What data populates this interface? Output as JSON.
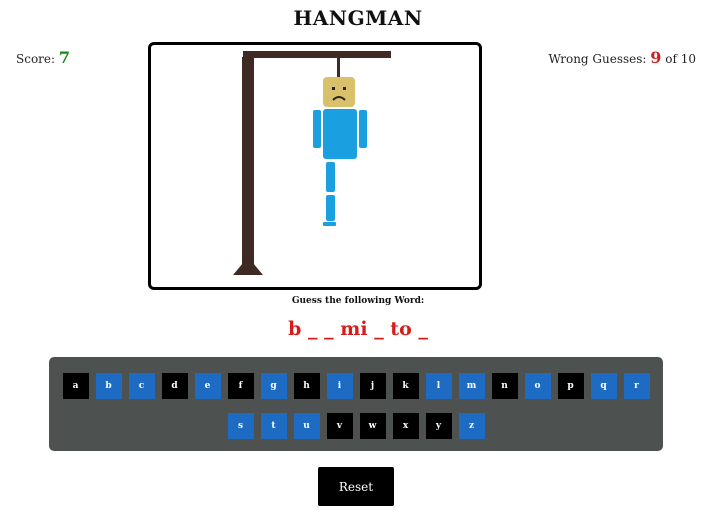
{
  "title": "HANGMAN",
  "score": {
    "label": "Score:",
    "value": "7"
  },
  "wrong_guesses": {
    "label": "Wrong Guesses:",
    "value": "9",
    "of_text": "of 10"
  },
  "prompt": "Guess the following Word:",
  "word_display": "b _ _ mi _ to _",
  "keyboard": {
    "row1": [
      {
        "letter": "a",
        "state": "guessed"
      },
      {
        "letter": "b",
        "state": "available"
      },
      {
        "letter": "c",
        "state": "available"
      },
      {
        "letter": "d",
        "state": "guessed"
      },
      {
        "letter": "e",
        "state": "available"
      },
      {
        "letter": "f",
        "state": "guessed"
      },
      {
        "letter": "g",
        "state": "available"
      },
      {
        "letter": "h",
        "state": "guessed"
      },
      {
        "letter": "i",
        "state": "available"
      },
      {
        "letter": "j",
        "state": "guessed"
      },
      {
        "letter": "k",
        "state": "guessed"
      },
      {
        "letter": "l",
        "state": "available"
      },
      {
        "letter": "m",
        "state": "available"
      },
      {
        "letter": "n",
        "state": "guessed"
      },
      {
        "letter": "o",
        "state": "available"
      },
      {
        "letter": "p",
        "state": "guessed"
      },
      {
        "letter": "q",
        "state": "available"
      },
      {
        "letter": "r",
        "state": "available"
      }
    ],
    "row2": [
      {
        "letter": "s",
        "state": "available"
      },
      {
        "letter": "t",
        "state": "available"
      },
      {
        "letter": "u",
        "state": "available"
      },
      {
        "letter": "v",
        "state": "guessed"
      },
      {
        "letter": "w",
        "state": "guessed"
      },
      {
        "letter": "x",
        "state": "guessed"
      },
      {
        "letter": "y",
        "state": "guessed"
      },
      {
        "letter": "z",
        "state": "available"
      }
    ]
  },
  "reset_label": "Reset",
  "colors": {
    "score": "#1a8a1a",
    "wrong": "#d81b1b",
    "key_guessed": "#000000",
    "key_available": "#1e6bc4",
    "keyboard_bg": "#4d5250",
    "gallows": "#3e2a22",
    "body": "#1a9fe0",
    "head": "#d9c06a"
  }
}
